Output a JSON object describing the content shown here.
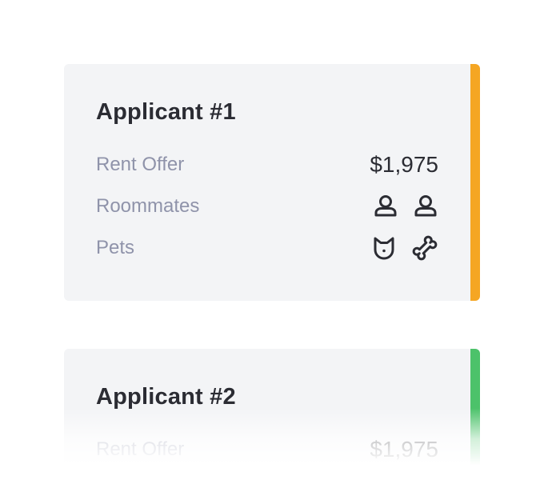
{
  "colors": {
    "card_background": "#f3f4f6",
    "applicant_1_accent": "#f5a623",
    "applicant_2_accent": "#4cc26a",
    "title_text": "#2b2c33",
    "label_text": "#8f93aa"
  },
  "applicants": [
    {
      "title": "Applicant #1",
      "rows": {
        "rent_label": "Rent Offer",
        "rent_value": "$1,975",
        "roommates_label": "Roommates",
        "roommate_icons": [
          "person-icon",
          "person-icon"
        ],
        "pets_label": "Pets",
        "pet_icons": [
          "cat-icon",
          "bone-icon"
        ]
      }
    },
    {
      "title": "Applicant #2",
      "rows": {
        "rent_label": "Rent Offer",
        "rent_value": "$1,975"
      }
    }
  ]
}
